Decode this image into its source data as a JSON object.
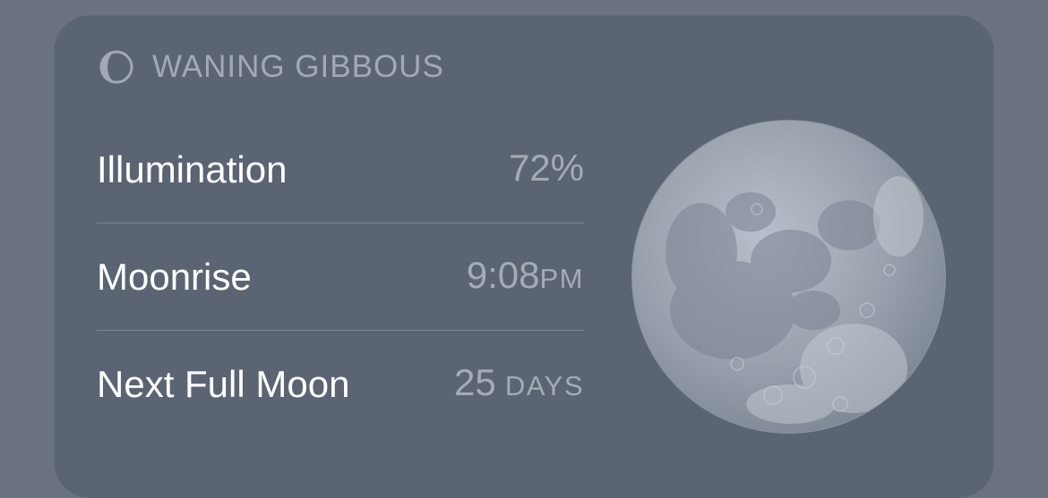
{
  "card": {
    "phase_icon": "waning-gibbous-moon-icon",
    "phase_name": "WANING GIBBOUS",
    "rows": [
      {
        "label": "Illumination",
        "value": "72%",
        "unit": ""
      },
      {
        "label": "Moonrise",
        "value": "9:08",
        "unit": "PM"
      },
      {
        "label": "Next Full Moon",
        "value": "25",
        "unit": " DAYS"
      }
    ],
    "image": "moon-image"
  },
  "colors": {
    "background": "#6b7381",
    "card": "#5b6473",
    "primary_text": "#ffffff",
    "secondary_text": "#a4abb7"
  }
}
